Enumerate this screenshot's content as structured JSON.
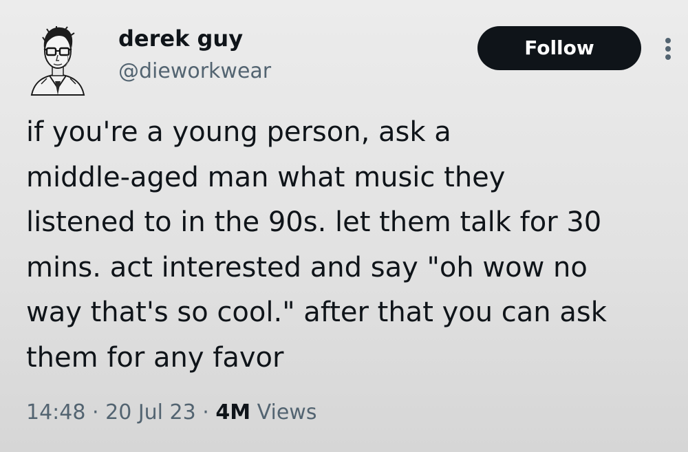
{
  "author": {
    "display_name": "derek guy",
    "handle": "@dieworkwear",
    "avatar_icon": "illustrated-portrait-avatar"
  },
  "actions": {
    "follow_label": "Follow",
    "more_icon": "more-vertical-icon"
  },
  "tweet": {
    "lines": [
      "if you're a young person, ask a",
      "middle-aged man what music they",
      "listened to in the 90s. let them talk for 30",
      "mins. act interested and say \"oh wow no",
      "way that's so cool.\" after that you can ask",
      "them for any favor"
    ]
  },
  "meta": {
    "time": "14:48",
    "separator": "·",
    "date": "20 Jul 23",
    "views_count": "4M",
    "views_label": "Views"
  },
  "colors": {
    "text_primary": "#0f1419",
    "text_secondary": "#536471",
    "button_bg": "#0f1419",
    "button_text": "#ffffff"
  }
}
